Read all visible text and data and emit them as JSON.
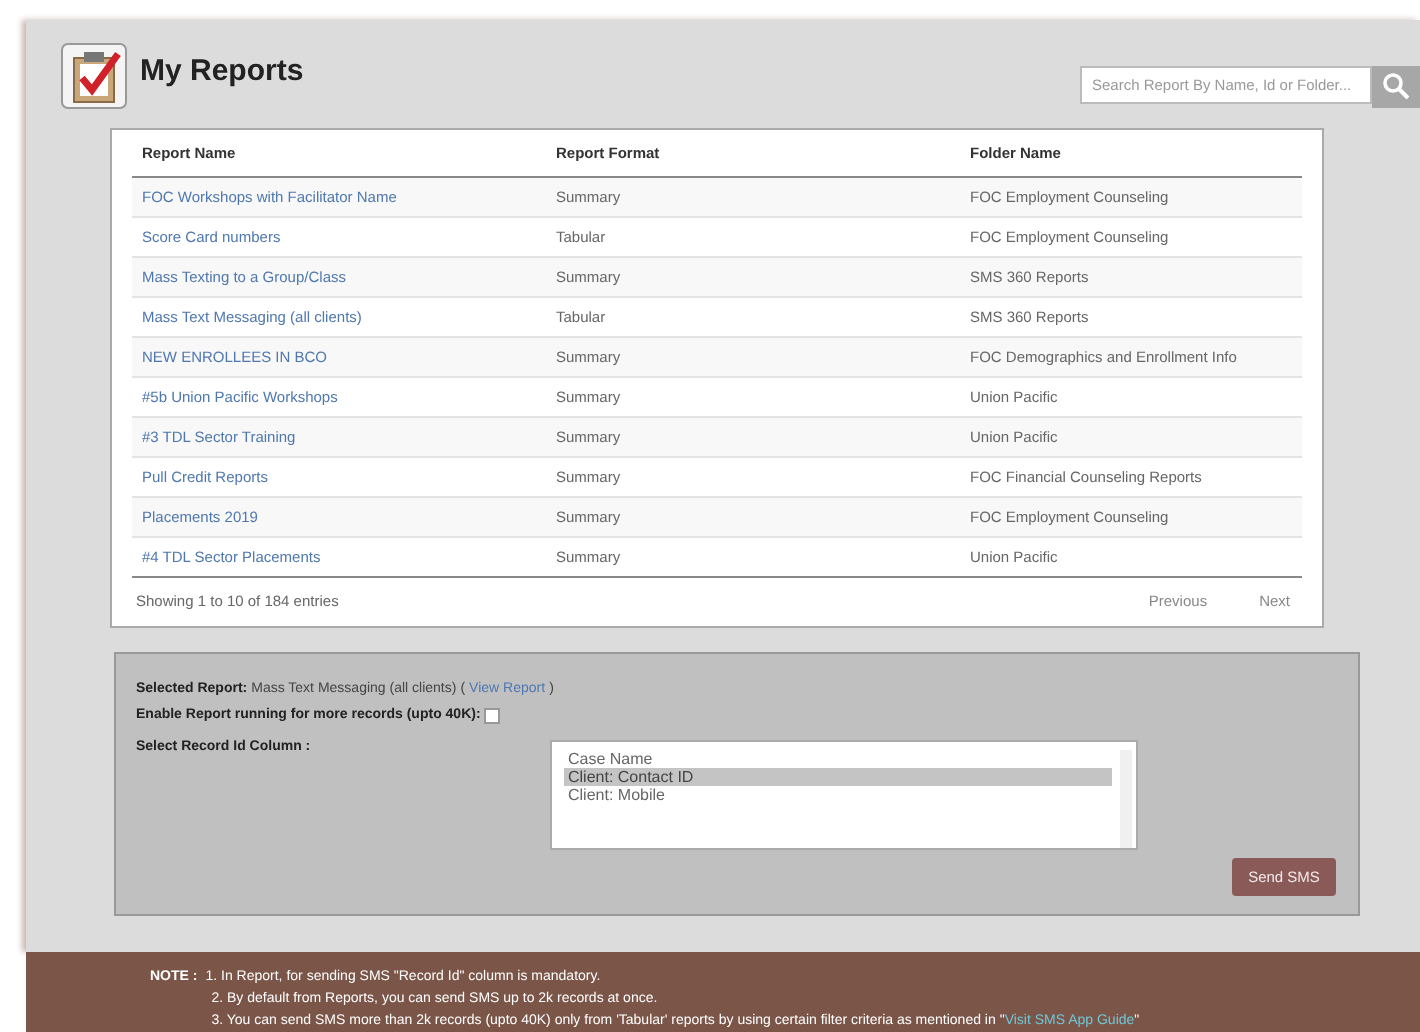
{
  "header": {
    "title": "My Reports",
    "search": {
      "placeholder": "Search Report By Name, Id or Folder..."
    }
  },
  "table": {
    "columns": [
      "Report Name",
      "Report Format",
      "Folder Name"
    ],
    "rows": [
      {
        "name": "FOC Workshops with Facilitator Name",
        "format": "Summary",
        "folder": "FOC Employment Counseling"
      },
      {
        "name": "Score Card numbers",
        "format": "Tabular",
        "folder": "FOC Employment Counseling"
      },
      {
        "name": "Mass Texting to a Group/Class",
        "format": "Summary",
        "folder": "SMS 360 Reports"
      },
      {
        "name": "Mass Text Messaging (all clients)",
        "format": "Tabular",
        "folder": "SMS 360 Reports"
      },
      {
        "name": "NEW ENROLLEES IN BCO",
        "format": "Summary",
        "folder": "FOC Demographics and Enrollment Info"
      },
      {
        "name": "#5b Union Pacific Workshops",
        "format": "Summary",
        "folder": "Union Pacific"
      },
      {
        "name": "#3 TDL Sector Training",
        "format": "Summary",
        "folder": "Union Pacific"
      },
      {
        "name": "Pull Credit Reports",
        "format": "Summary",
        "folder": "FOC Financial Counseling Reports"
      },
      {
        "name": "Placements 2019",
        "format": "Summary",
        "folder": "FOC Employment Counseling"
      },
      {
        "name": "#4 TDL Sector Placements",
        "format": "Summary",
        "folder": "Union Pacific"
      }
    ],
    "info": "Showing 1 to 10 of 184 entries",
    "prev": "Previous",
    "next": "Next"
  },
  "sms": {
    "selected_label": "Selected Report:",
    "selected_value": "Mass Text Messaging (all clients)",
    "open_paren": "(",
    "view_link": "View Report",
    "close_paren": ")",
    "enable_label": "Enable Report running for more records (upto 40K):",
    "enable_checked": false,
    "column_label": "Select Record Id Column :",
    "options": [
      {
        "label": "Case Name",
        "selected": false
      },
      {
        "label": "Client: Contact ID",
        "selected": true
      },
      {
        "label": "Client: Mobile",
        "selected": false
      }
    ],
    "send": "Send SMS"
  },
  "note": {
    "label": "NOTE :",
    "lines": [
      "1. In Report, for sending SMS \"Record Id\" column is mandatory.",
      "2. By default from Reports, you can send SMS up to 2k records at once.",
      "3. You can send SMS more than 2k records (upto 40K) only from 'Tabular' reports by using certain filter criteria as mentioned in \""
    ],
    "link": "Visit SMS App Guide",
    "link_tail": "\""
  }
}
